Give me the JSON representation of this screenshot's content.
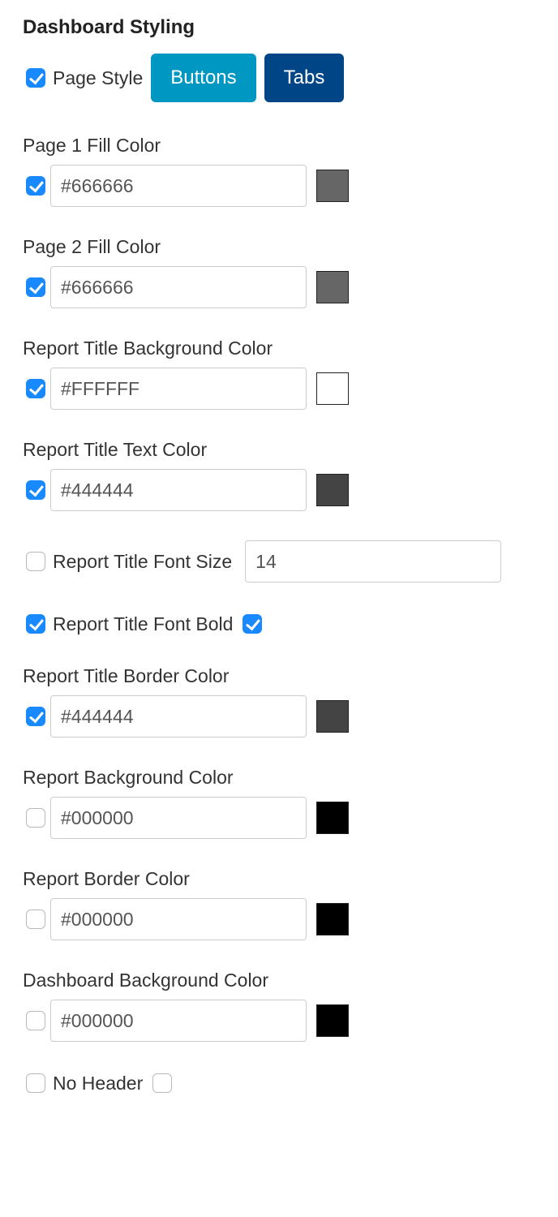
{
  "title": "Dashboard Styling",
  "pageStyle": {
    "enabled": true,
    "label": "Page Style",
    "buttons": "Buttons",
    "tabs": "Tabs"
  },
  "page1Fill": {
    "enabled": true,
    "label": "Page 1 Fill Color",
    "value": "#666666",
    "swatch": "#666666"
  },
  "page2Fill": {
    "enabled": true,
    "label": "Page 2 Fill Color",
    "value": "#666666",
    "swatch": "#666666"
  },
  "titleBg": {
    "enabled": true,
    "label": "Report Title Background Color",
    "value": "#FFFFFF",
    "swatch": "#FFFFFF"
  },
  "titleText": {
    "enabled": true,
    "label": "Report Title Text Color",
    "value": "#444444",
    "swatch": "#444444"
  },
  "titleFontSize": {
    "enabled": false,
    "label": "Report Title Font Size",
    "value": "14"
  },
  "titleBold": {
    "enabled": true,
    "label": "Report Title Font Bold",
    "value": true
  },
  "titleBorder": {
    "enabled": true,
    "label": "Report Title Border Color",
    "value": "#444444",
    "swatch": "#444444"
  },
  "reportBg": {
    "enabled": false,
    "label": "Report Background Color",
    "value": "#000000",
    "swatch": "#000000"
  },
  "reportBorder": {
    "enabled": false,
    "label": "Report Border Color",
    "value": "#000000",
    "swatch": "#000000"
  },
  "dashBg": {
    "enabled": false,
    "label": "Dashboard Background Color",
    "value": "#000000",
    "swatch": "#000000"
  },
  "noHeader": {
    "enabled": false,
    "label": "No Header",
    "value": false
  }
}
